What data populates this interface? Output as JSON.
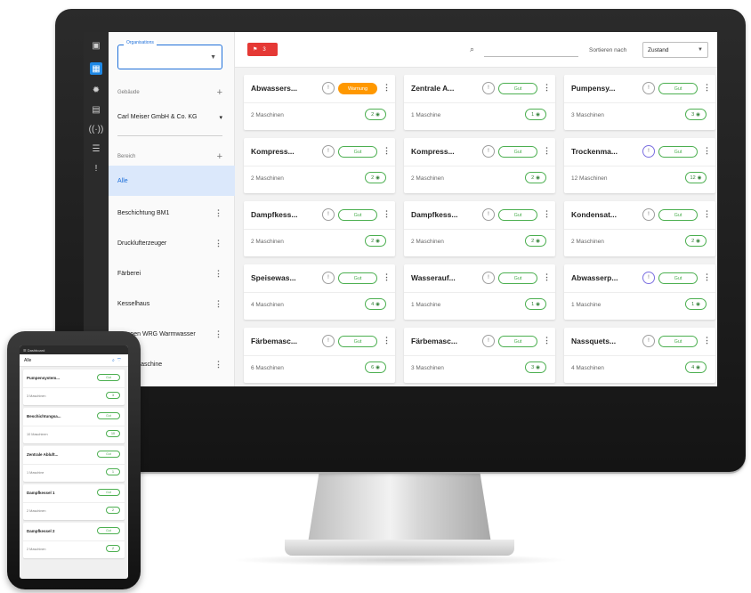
{
  "sidebar": {
    "org_label": "Organisations",
    "gebaeude_label": "Gebäude",
    "gebaeude_value": "Carl Meiser GmbH & Co. KG",
    "bereich_label": "Bereich",
    "plus": "+",
    "areas": [
      {
        "label": "Alle"
      },
      {
        "label": "Beschichtung BM1"
      },
      {
        "label": "Drucklufterzeuger"
      },
      {
        "label": "Färberei"
      },
      {
        "label": "Kesselhaus"
      },
      {
        "label": "Pumpen WRG Warmwasser"
      },
      {
        "label": "Spannmaschine"
      }
    ]
  },
  "topbar": {
    "alert_count": "3",
    "sort_label": "Sortieren nach",
    "sort_value": "Zustand"
  },
  "cards": [
    {
      "title": "Abwassers...",
      "status": "Warnung",
      "count": "2 Maschinen",
      "pill": "2"
    },
    {
      "title": "Zentrale A...",
      "status": "Gut",
      "count": "1 Maschine",
      "pill": "1"
    },
    {
      "title": "Pumpensy...",
      "status": "Gut",
      "count": "3 Maschinen",
      "pill": "3"
    },
    {
      "title": "Kompress...",
      "status": "Gut",
      "count": "2 Maschinen",
      "pill": "2"
    },
    {
      "title": "Kompress...",
      "status": "Gut",
      "count": "2 Maschinen",
      "pill": "2"
    },
    {
      "title": "Trockenma...",
      "status": "Gut",
      "count": "12 Maschinen",
      "pill": "12"
    },
    {
      "title": "Dampfkess...",
      "status": "Gut",
      "count": "2 Maschinen",
      "pill": "2"
    },
    {
      "title": "Dampfkess...",
      "status": "Gut",
      "count": "2 Maschinen",
      "pill": "2"
    },
    {
      "title": "Kondensat...",
      "status": "Gut",
      "count": "2 Maschinen",
      "pill": "2"
    },
    {
      "title": "Speisewas...",
      "status": "Gut",
      "count": "4 Maschinen",
      "pill": "4"
    },
    {
      "title": "Wasserauf...",
      "status": "Gut",
      "count": "1 Maschine",
      "pill": "1"
    },
    {
      "title": "Abwasserp...",
      "status": "Gut",
      "count": "1 Maschine",
      "pill": "1"
    },
    {
      "title": "Färbemasc...",
      "status": "Gut",
      "count": "6 Maschinen",
      "pill": "6"
    },
    {
      "title": "Färbemasc...",
      "status": "Gut",
      "count": "3 Maschinen",
      "pill": "3"
    },
    {
      "title": "Nassquets...",
      "status": "Gut",
      "count": "4 Maschinen",
      "pill": "4"
    }
  ],
  "phone": {
    "topbar_title": "Dashboard",
    "filter_label": "Alle",
    "cards": [
      {
        "title": "Pumpensystem...",
        "status": "Gut",
        "count": "3 Maschinen",
        "pill": "3"
      },
      {
        "title": "Beschichtungsa...",
        "status": "Gut",
        "count": "10 Maschinen",
        "pill": "10"
      },
      {
        "title": "Zentrale Abluft...",
        "status": "Gut",
        "count": "1 Maschine",
        "pill": "1"
      },
      {
        "title": "Dampfkessel 1",
        "status": "Gut",
        "count": "2 Maschinen",
        "pill": "2"
      },
      {
        "title": "Dampfkessel 2",
        "status": "Gut",
        "count": "2 Maschinen",
        "pill": "2"
      }
    ]
  },
  "colors": {
    "accent": "#1e6fd9",
    "good": "#4caf50",
    "warning": "#ff9800",
    "alert": "#e53935",
    "rail": "#2b2b2b"
  }
}
